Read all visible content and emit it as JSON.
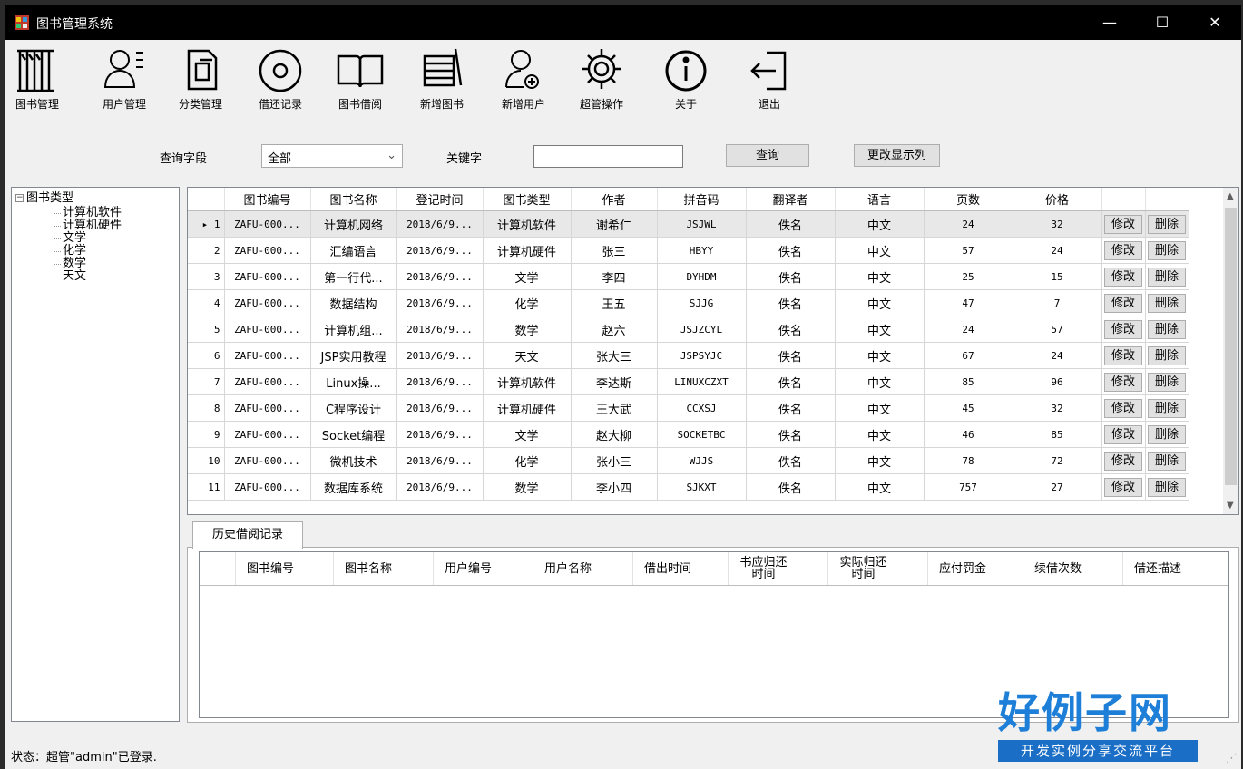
{
  "window": {
    "title": "图书管理系统",
    "minimize": "—",
    "maximize": "☐",
    "close": "✕"
  },
  "toolbar": [
    {
      "label": "图书管理",
      "icon": "bookshelf-icon"
    },
    {
      "label": "用户管理",
      "icon": "user-list-icon"
    },
    {
      "label": "分类管理",
      "icon": "category-docs-icon"
    },
    {
      "label": "借还记录",
      "icon": "record-circle-icon"
    },
    {
      "label": "图书借阅",
      "icon": "open-book-icon"
    },
    {
      "label": "新增图书",
      "icon": "add-book-icon"
    },
    {
      "label": "新增用户",
      "icon": "add-user-icon"
    },
    {
      "label": "超管操作",
      "icon": "gear-icon"
    },
    {
      "label": "关于",
      "icon": "info-icon"
    },
    {
      "label": "退出",
      "icon": "exit-icon"
    }
  ],
  "query": {
    "field_label": "查询字段",
    "field_value": "全部",
    "keyword_label": "关键字",
    "keyword_value": "",
    "search_button": "查询",
    "columns_button": "更改显示列"
  },
  "tree": {
    "root": "图书类型",
    "children": [
      "计算机软件",
      "计算机硬件",
      "文学",
      "化学",
      "数学",
      "天文"
    ]
  },
  "grid": {
    "columns": [
      "图书编号",
      "图书名称",
      "登记时间",
      "图书类型",
      "作者",
      "拼音码",
      "翻译者",
      "语言",
      "页数",
      "价格"
    ],
    "edit_label": "修改",
    "delete_label": "删除",
    "rows": [
      {
        "no": "1",
        "id": "ZAFU-000...",
        "name": "计算机网络",
        "date": "2018/6/9...",
        "type": "计算机软件",
        "author": "谢希仁",
        "pinyin": "JSJWL",
        "translator": "佚名",
        "lang": "中文",
        "pages": "24",
        "price": "32"
      },
      {
        "no": "2",
        "id": "ZAFU-000...",
        "name": "汇编语言",
        "date": "2018/6/9...",
        "type": "计算机硬件",
        "author": "张三",
        "pinyin": "HBYY",
        "translator": "佚名",
        "lang": "中文",
        "pages": "57",
        "price": "24"
      },
      {
        "no": "3",
        "id": "ZAFU-000...",
        "name": "第一行代...",
        "date": "2018/6/9...",
        "type": "文学",
        "author": "李四",
        "pinyin": "DYHDM",
        "translator": "佚名",
        "lang": "中文",
        "pages": "25",
        "price": "15"
      },
      {
        "no": "4",
        "id": "ZAFU-000...",
        "name": "数据结构",
        "date": "2018/6/9...",
        "type": "化学",
        "author": "王五",
        "pinyin": "SJJG",
        "translator": "佚名",
        "lang": "中文",
        "pages": "47",
        "price": "7"
      },
      {
        "no": "5",
        "id": "ZAFU-000...",
        "name": "计算机组...",
        "date": "2018/6/9...",
        "type": "数学",
        "author": "赵六",
        "pinyin": "JSJZCYL",
        "translator": "佚名",
        "lang": "中文",
        "pages": "24",
        "price": "57"
      },
      {
        "no": "6",
        "id": "ZAFU-000...",
        "name": "JSP实用教程",
        "date": "2018/6/9...",
        "type": "天文",
        "author": "张大三",
        "pinyin": "JSPSYJC",
        "translator": "佚名",
        "lang": "中文",
        "pages": "67",
        "price": "24"
      },
      {
        "no": "7",
        "id": "ZAFU-000...",
        "name": "Linux操...",
        "date": "2018/6/9...",
        "type": "计算机软件",
        "author": "李达斯",
        "pinyin": "LINUXCZXT",
        "translator": "佚名",
        "lang": "中文",
        "pages": "85",
        "price": "96"
      },
      {
        "no": "8",
        "id": "ZAFU-000...",
        "name": "C程序设计",
        "date": "2018/6/9...",
        "type": "计算机硬件",
        "author": "王大武",
        "pinyin": "CCXSJ",
        "translator": "佚名",
        "lang": "中文",
        "pages": "45",
        "price": "32"
      },
      {
        "no": "9",
        "id": "ZAFU-000...",
        "name": "Socket编程",
        "date": "2018/6/9...",
        "type": "文学",
        "author": "赵大柳",
        "pinyin": "SOCKETBC",
        "translator": "佚名",
        "lang": "中文",
        "pages": "46",
        "price": "85"
      },
      {
        "no": "10",
        "id": "ZAFU-000...",
        "name": "微机技术",
        "date": "2018/6/9...",
        "type": "化学",
        "author": "张小三",
        "pinyin": "WJJS",
        "translator": "佚名",
        "lang": "中文",
        "pages": "78",
        "price": "72"
      },
      {
        "no": "11",
        "id": "ZAFU-000...",
        "name": "数据库系统",
        "date": "2018/6/9...",
        "type": "数学",
        "author": "李小四",
        "pinyin": "SJKXT",
        "translator": "佚名",
        "lang": "中文",
        "pages": "757",
        "price": "27"
      }
    ]
  },
  "history": {
    "tab_label": "历史借阅记录",
    "columns": [
      "图书编号",
      "图书名称",
      "用户编号",
      "用户名称",
      "借出时间",
      "书应归还时间",
      "实际归还时间",
      "应付罚金",
      "续借次数",
      "借还描述"
    ]
  },
  "status": {
    "text": "状态：超管\"admin\"已登录."
  },
  "logo": {
    "main": "好例子网",
    "sub": "开发实例分享交流平台"
  }
}
